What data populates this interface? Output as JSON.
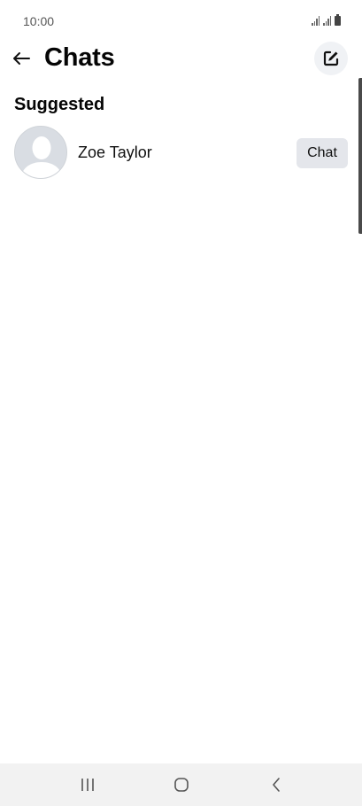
{
  "status_bar": {
    "time": "10:00"
  },
  "header": {
    "title": "Chats"
  },
  "suggested": {
    "title": "Suggested",
    "items": [
      {
        "name": "Zoe Taylor",
        "action_label": "Chat"
      }
    ]
  },
  "icons": {
    "back": "arrow-left-icon",
    "compose": "compose-icon",
    "avatar": "default-avatar-icon",
    "nav_recents": "recents-icon",
    "nav_home": "home-icon",
    "nav_back": "chevron-left-icon"
  },
  "colors": {
    "text": "#050505",
    "chip_background": "#e4e6eb",
    "compose_background": "#f0f2f5",
    "nav_background": "#f2f2f2"
  }
}
